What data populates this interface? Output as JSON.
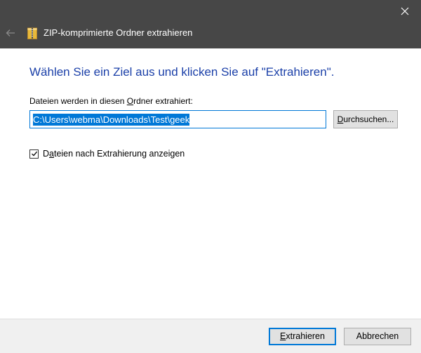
{
  "window": {
    "title": "ZIP-komprimierte Ordner extrahieren",
    "close_icon": "close-icon",
    "back_icon": "back-arrow-icon",
    "app_icon": "zip-folder-icon"
  },
  "main": {
    "heading": "Wählen Sie ein Ziel aus und klicken Sie auf \"Extrahieren\".",
    "folder_label_pre": "Dateien werden in diesen ",
    "folder_label_accel": "O",
    "folder_label_post": "rdner extrahiert:",
    "path_value": "C:\\Users\\webma\\Downloads\\Test\\geek",
    "browse_accel": "D",
    "browse_rest": "urchsuchen...",
    "checkbox_checked": true,
    "checkbox_accel": "a",
    "checkbox_pre": "D",
    "checkbox_post": "teien nach Extrahierung anzeigen"
  },
  "footer": {
    "extract_accel": "E",
    "extract_rest": "xtrahieren",
    "cancel_label": "Abbrechen"
  },
  "colors": {
    "titlebar": "#474747",
    "heading": "#1a3fa8",
    "accent": "#0078d7"
  }
}
